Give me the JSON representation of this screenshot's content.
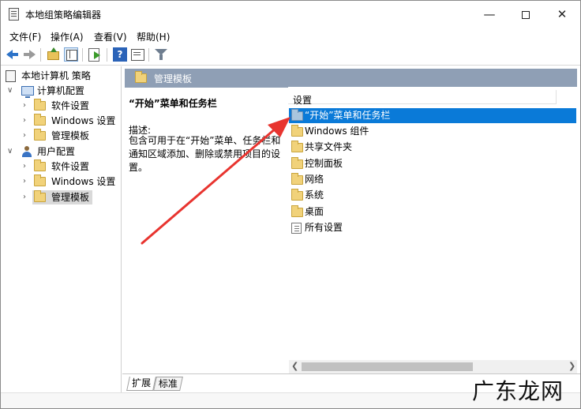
{
  "window": {
    "title": "本地组策略编辑器",
    "minimize": "—",
    "close": "✕"
  },
  "menu": {
    "items": [
      {
        "label": "文件(F)"
      },
      {
        "label": "操作(A)"
      },
      {
        "label": "查看(V)"
      },
      {
        "label": "帮助(H)"
      }
    ]
  },
  "toolbar": {
    "help_label": "?"
  },
  "tree": {
    "root": "本地计算机 策略",
    "computer": "计算机配置",
    "computer_children": [
      "软件设置",
      "Windows 设置",
      "管理模板"
    ],
    "user": "用户配置",
    "user_children": [
      "软件设置",
      "Windows 设置",
      "管理模板"
    ],
    "selected": "管理模板"
  },
  "header": {
    "title": "管理模板"
  },
  "description": {
    "title": "“开始”菜单和任务栏",
    "label": "描述:",
    "text": "包含可用于在“开始”菜单、任务栏和通知区域添加、删除或禁用项目的设置。"
  },
  "list": {
    "column": "设置",
    "items": [
      {
        "label": "“开始”菜单和任务栏",
        "selected": true
      },
      {
        "label": "Windows 组件",
        "selected": false
      },
      {
        "label": "共享文件夹",
        "selected": false
      },
      {
        "label": "控制面板",
        "selected": false
      },
      {
        "label": "网络",
        "selected": false
      },
      {
        "label": "系统",
        "selected": false
      },
      {
        "label": "桌面",
        "selected": false
      },
      {
        "label": "所有设置",
        "selected": false
      }
    ]
  },
  "tabs": [
    "扩展",
    "标准"
  ],
  "watermark": "广东龙网",
  "colors": {
    "header_band": "#8f9fb5",
    "selection": "#0a7ad8",
    "annotation_arrow": "#e8342f"
  }
}
